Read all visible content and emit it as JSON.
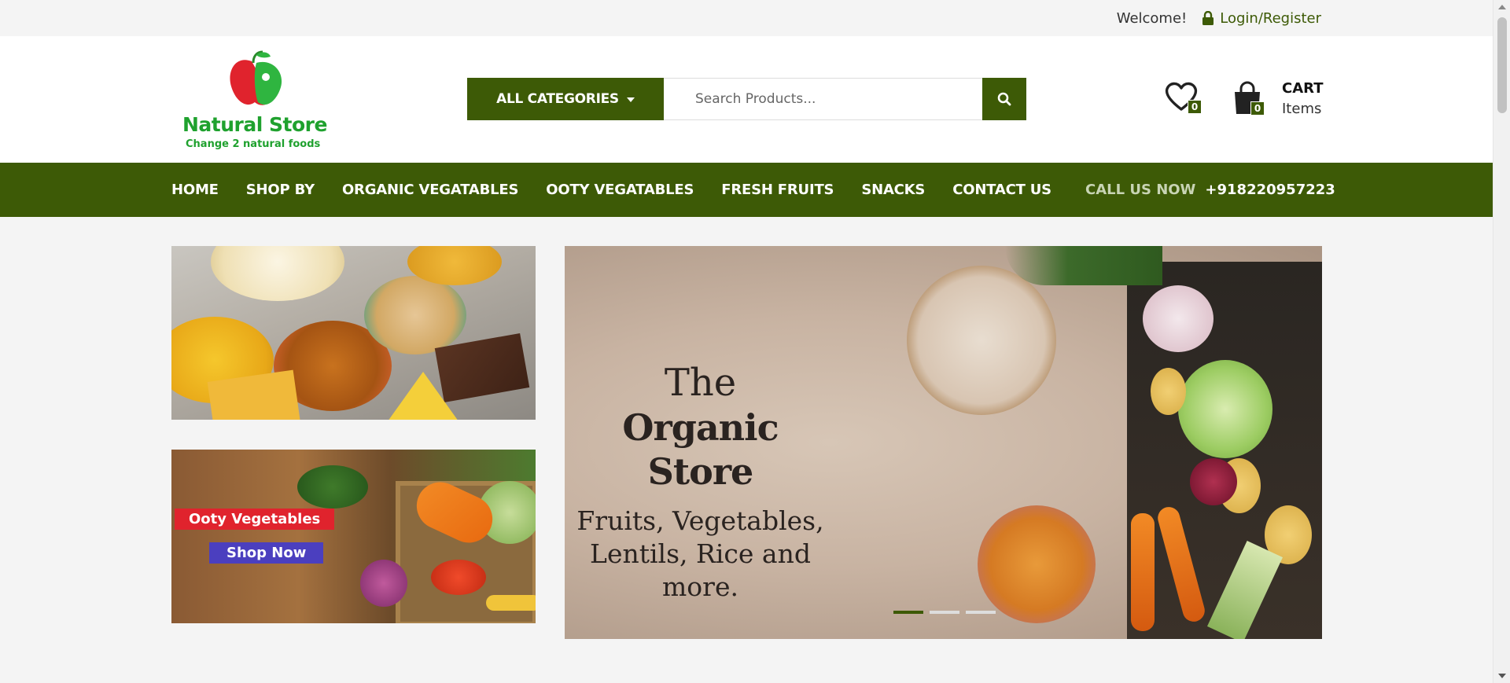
{
  "topbar": {
    "welcome": "Welcome!",
    "login_label": "Login/Register"
  },
  "header": {
    "logo_title": "Natural Store",
    "logo_tagline": "Change 2 natural foods",
    "categories_label": "ALL CATEGORIES",
    "search_placeholder": "Search Products...",
    "wishlist_count": "0",
    "cart_count": "0",
    "cart_title": "CART",
    "cart_items": "Items"
  },
  "nav": {
    "items": [
      {
        "label": "HOME"
      },
      {
        "label": "SHOP BY"
      },
      {
        "label": "ORGANIC VEGATABLES"
      },
      {
        "label": "OOTY VEGATABLES"
      },
      {
        "label": "FRESH FRUITS"
      },
      {
        "label": "SNACKS"
      },
      {
        "label": "CONTACT US"
      }
    ],
    "call_label": "CALL US NOW",
    "call_number": "+918220957223"
  },
  "banners": {
    "veg_tag": "Ooty Vegetables",
    "veg_shop": "Shop Now"
  },
  "hero": {
    "line1": "The",
    "line2": "Organic Store",
    "line3": "Fruits, Vegetables,",
    "line4": "Lentils, Rice and more.",
    "slide_count": 3,
    "active_slide": 1
  },
  "colors": {
    "brand_green": "#3d5a06",
    "logo_green": "#1fa12e",
    "tag_red": "#e0232d",
    "shop_blue": "#4b3fbf"
  }
}
